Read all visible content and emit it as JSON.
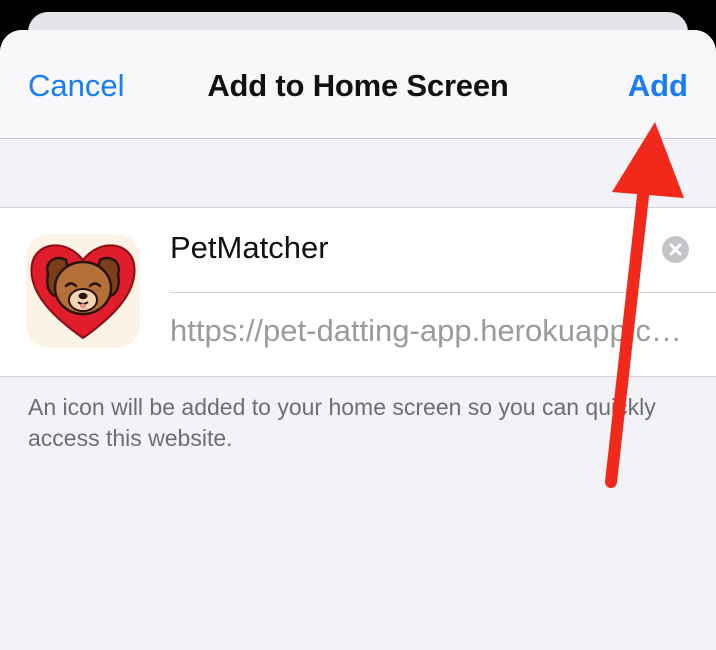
{
  "nav": {
    "cancel_label": "Cancel",
    "title": "Add to Home Screen",
    "add_label": "Add"
  },
  "bookmark": {
    "name_value": "PetMatcher",
    "url_value": "https://pet-datting-app.herokuapp.com",
    "icon": "petmatcher-dog-heart-icon",
    "clear_icon": "clear-x-icon"
  },
  "footer_note": "An icon will be added to your home screen so you can quickly access this website.",
  "colors": {
    "accent": "#1a7cf5",
    "annotation_arrow": "#f2281b",
    "heart": "#e01d2b",
    "dog_fur": "#b5703a"
  }
}
